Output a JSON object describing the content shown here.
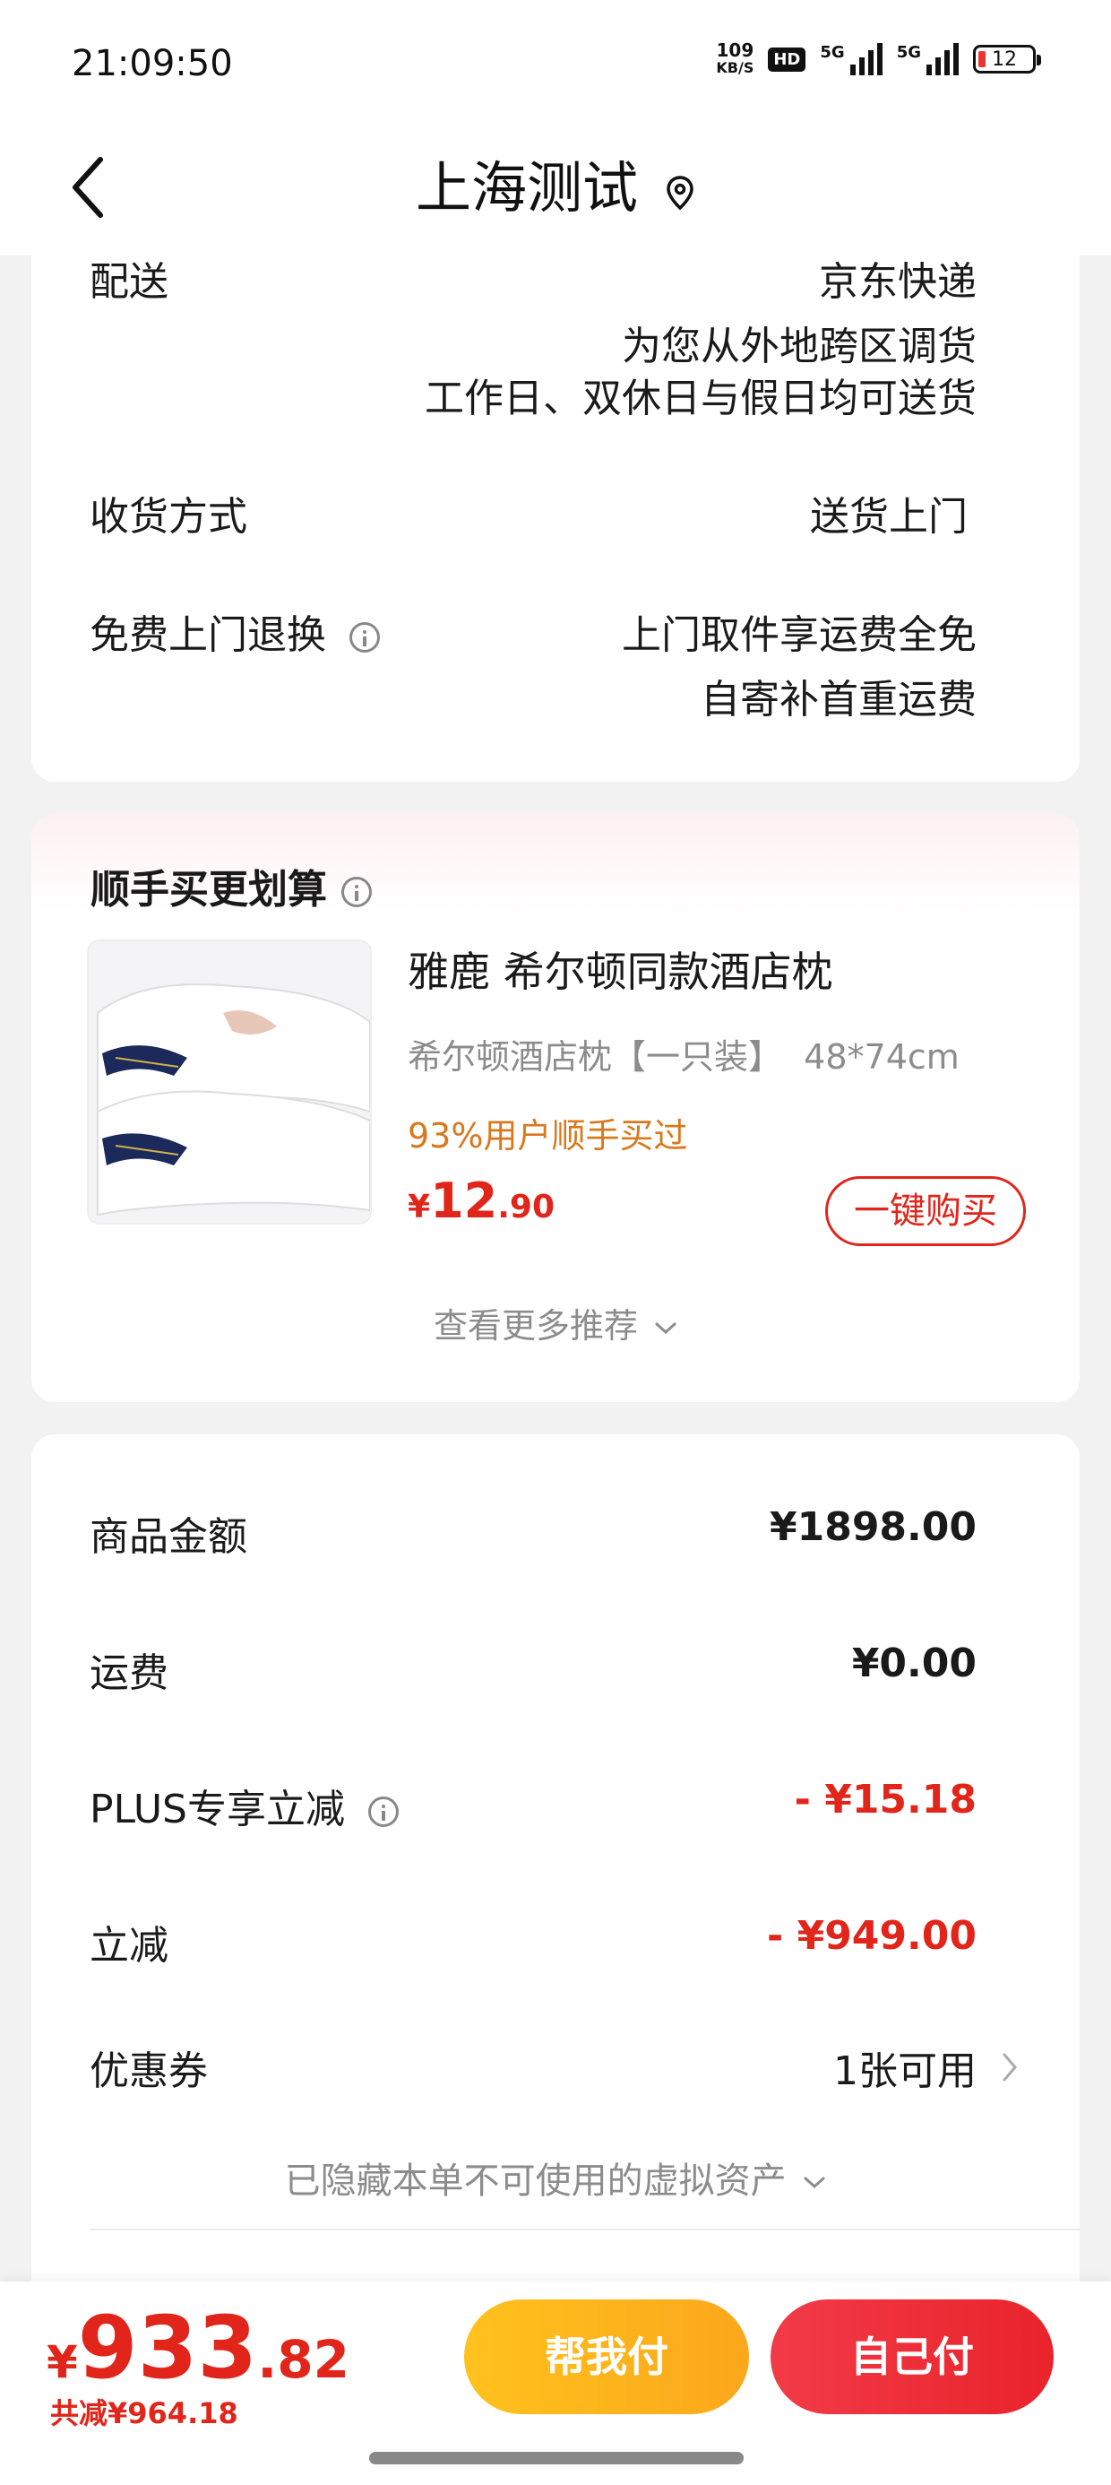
{
  "status_bar": {
    "time": "21:09:50",
    "speed_value": "109",
    "speed_unit": "KB/S",
    "hd_label": "HD",
    "signal1_label": "5G",
    "signal2_label": "5G",
    "battery": "12"
  },
  "nav": {
    "title": "上海测试"
  },
  "delivery": {
    "label": "配送",
    "value_line1": "京东快递",
    "value_line2": "为您从外地跨区调货",
    "value_line3": "工作日、双休日与假日均可送货",
    "receive_label": "收货方式",
    "receive_value": "送货上门",
    "return_label": "免费上门退换",
    "return_value1": "上门取件享运费全免",
    "return_value2": "自寄补首重运费"
  },
  "recommend": {
    "title": "顺手买更划算",
    "product_name": "雅鹿 希尔顿同款酒店枕",
    "product_spec": "希尔顿酒店枕【一只装】  48*74cm",
    "product_stat": "93%用户顺手买过",
    "price_symbol": "¥",
    "price_int": "12",
    "price_dec": ".90",
    "buy_label": "一键购买",
    "more_label": "查看更多推荐"
  },
  "summary": {
    "goods_label": "商品金额",
    "goods_value": "¥1898.00",
    "shipping_label": "运费",
    "shipping_value": "¥0.00",
    "plus_label": "PLUS专享立减",
    "plus_value": "- ¥15.18",
    "discount_label": "立减",
    "discount_value": "- ¥949.00",
    "coupon_label": "优惠券",
    "coupon_value": "1张可用",
    "hidden_label": "已隐藏本单不可使用的虚拟资产"
  },
  "bottom": {
    "price_symbol": "¥",
    "price_int": "933",
    "price_dec": ".82",
    "saved": "共减¥964.18",
    "help_pay": "帮我付",
    "self_pay": "自己付"
  },
  "colors": {
    "accent_red": "#e1251b",
    "stat_orange": "#d9781c",
    "help_yellow": "#ffc21d"
  }
}
